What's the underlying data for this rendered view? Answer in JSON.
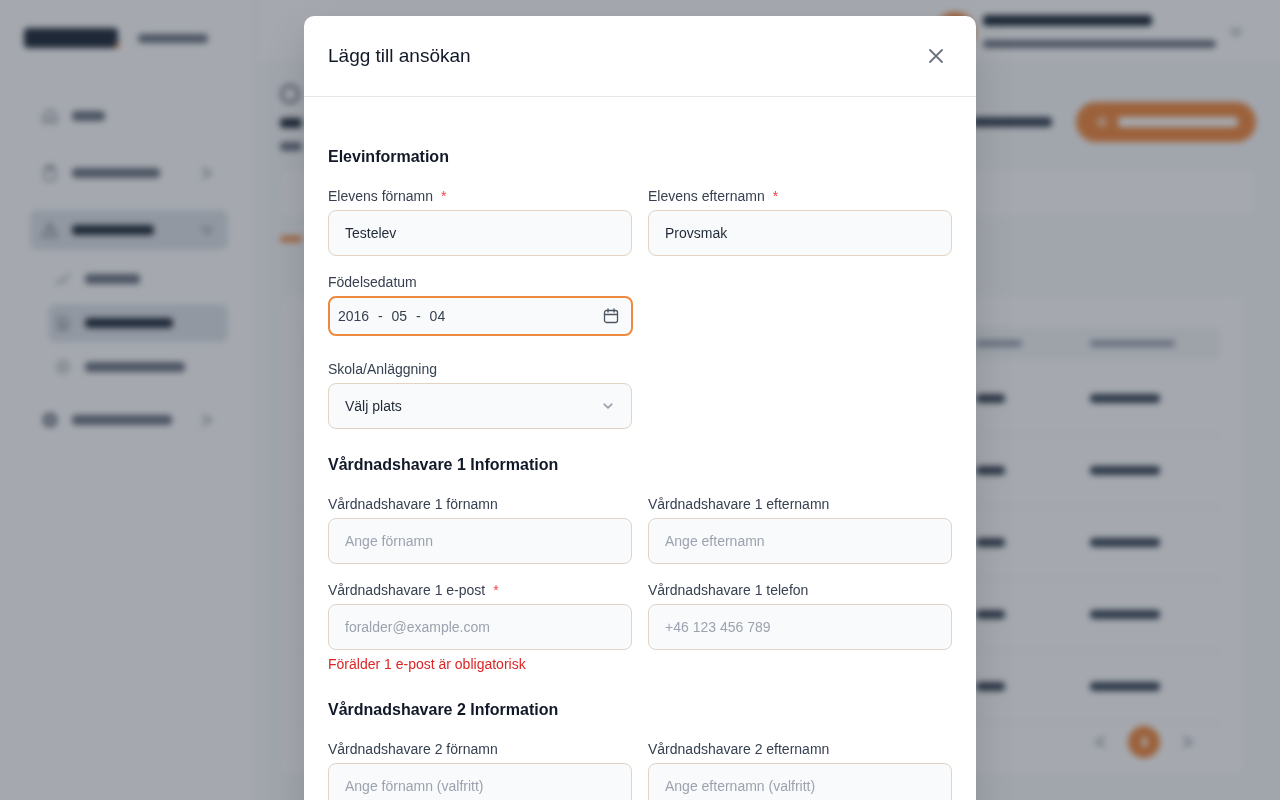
{
  "background": {
    "sidebar": {
      "items": [
        {
          "kind": "link",
          "selected": false
        },
        {
          "kind": "group",
          "selected": false
        },
        {
          "kind": "group",
          "selected": true,
          "children": [
            {
              "selected": false
            },
            {
              "selected": true
            },
            {
              "selected": false
            }
          ]
        },
        {
          "kind": "group",
          "selected": false
        }
      ]
    },
    "pagination": {
      "pages": [
        {
          "selected": true
        }
      ]
    }
  },
  "modal": {
    "title": "Lägg till ansökan",
    "sections": [
      {
        "title": "Elevinformation",
        "rows": [
          [
            {
              "kind": "text",
              "label": "Elevens förnamn",
              "required_mark": "*",
              "value": "Testelev"
            },
            {
              "kind": "text",
              "label": "Elevens efternamn",
              "required_mark": "*",
              "value": "Provsmak"
            }
          ],
          [
            {
              "kind": "date",
              "label": "Födelsedatum",
              "value": "2016 - 05 - 04",
              "focused": true
            }
          ],
          [
            {
              "kind": "select",
              "label": "Skola/Anläggning",
              "value": "Välj plats"
            }
          ]
        ]
      },
      {
        "title": "Vårdnadshavare 1 Information",
        "rows": [
          [
            {
              "kind": "text",
              "label": "Vårdnadshavare 1 förnamn",
              "placeholder": "Ange förnamn"
            },
            {
              "kind": "text",
              "label": "Vårdnadshavare 1 efternamn",
              "placeholder": "Ange efternamn"
            }
          ],
          [
            {
              "kind": "text",
              "label": "Vårdnadshavare 1 e-post",
              "required_mark": "*",
              "placeholder": "foralder@example.com",
              "error": "Förälder 1 e-post är obligatorisk"
            },
            {
              "kind": "text",
              "label": "Vårdnadshavare 1 telefon",
              "placeholder": "+46 123 456 789"
            }
          ]
        ]
      },
      {
        "title": "Vårdnadshavare 2 Information",
        "rows": [
          [
            {
              "kind": "text",
              "label": "Vårdnadshavare 2 förnamn",
              "placeholder": "Ange förnamn (valfritt)"
            },
            {
              "kind": "text",
              "label": "Vårdnadshavare 2 efternamn",
              "placeholder": "Ange efternamn (valfritt)"
            }
          ]
        ]
      }
    ]
  }
}
